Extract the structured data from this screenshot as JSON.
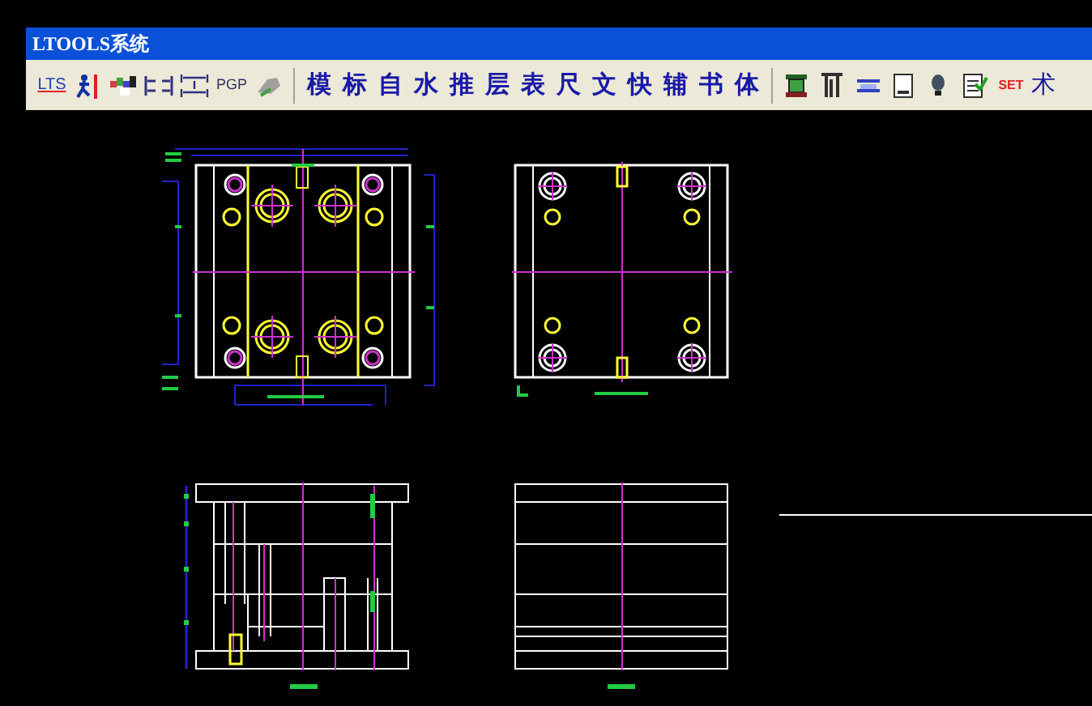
{
  "window": {
    "title": "LTOOLS系统"
  },
  "toolbar": {
    "lts_button": "LTS",
    "pgp_button": "PGP",
    "char_buttons": [
      "模",
      "标",
      "自",
      "水",
      "推",
      "层",
      "表",
      "尺",
      "文",
      "快",
      "辅",
      "书",
      "体"
    ],
    "set_button": "SET",
    "last_button": "术"
  }
}
